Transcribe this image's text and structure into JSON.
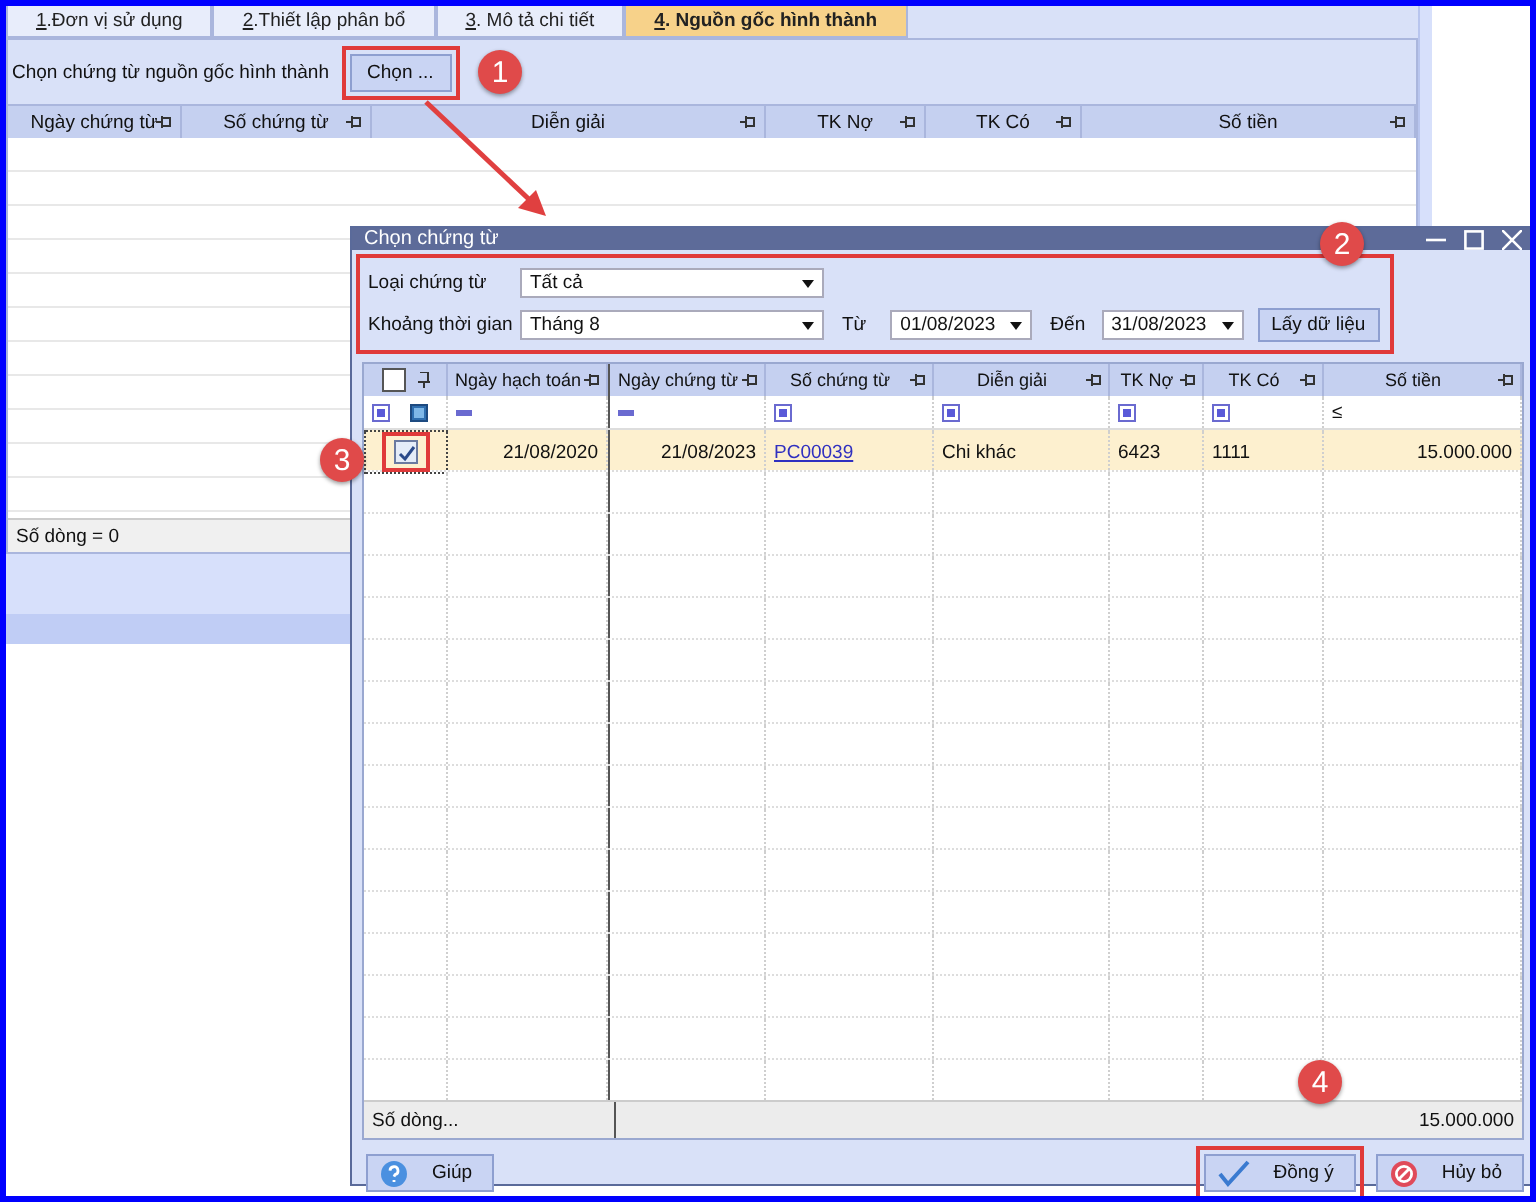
{
  "tabs": [
    {
      "label": "1.Đơn vị sử dụng",
      "selected": false
    },
    {
      "label": "2.Thiết lập phân bổ",
      "selected": false
    },
    {
      "label": "3. Mô tả chi tiết",
      "selected": false
    },
    {
      "label": "4. Nguồn gốc hình thành",
      "selected": true
    }
  ],
  "toolbar": {
    "label": "Chọn chứng từ nguồn gốc hình thành",
    "button": "Chọn ..."
  },
  "grid": {
    "columns": [
      "Ngày chứng từ",
      "Số chứng từ",
      "Diễn giải",
      "TK Nợ",
      "TK Có",
      "Số tiền"
    ],
    "footer": "Số dòng = 0"
  },
  "dialog": {
    "title": "Chọn chứng từ",
    "filters": {
      "type_label": "Loại chứng từ",
      "type_value": "Tất cả",
      "period_label": "Khoảng thời gian",
      "period_value": "Tháng 8",
      "from_label": "Từ",
      "from_value": "01/08/2023",
      "to_label": "Đến",
      "to_value": "31/08/2023",
      "fetch_button": "Lấy dữ liệu"
    },
    "table": {
      "select_all_checked": false,
      "columns": [
        "Ngày hạch toán",
        "Ngày chứng từ",
        "Số chứng từ",
        "Diễn giải",
        "TK Nợ",
        "TK Có",
        "Số tiền"
      ],
      "filter_row": [
        {
          "kind": "icons"
        },
        {
          "kind": "dash"
        },
        {
          "kind": "dash"
        },
        {
          "kind": "square"
        },
        {
          "kind": "square"
        },
        {
          "kind": "square"
        },
        {
          "kind": "square"
        },
        {
          "kind": "text",
          "text": "≤"
        }
      ],
      "rows": [
        {
          "checked": true,
          "selected": true,
          "posting_date": "21/08/2020",
          "doc_date": "21/08/2023",
          "doc_no": "PC00039",
          "description": "Chi khác",
          "debit": "6423",
          "credit": "1111",
          "amount": "15.000.000"
        }
      ],
      "footer_label": "Số dòng...",
      "footer_total": "15.000.000"
    },
    "buttons": {
      "help": "Giúp",
      "ok": "Đồng ý",
      "cancel": "Hủy bỏ"
    }
  },
  "annotations": [
    "1",
    "2",
    "3",
    "4"
  ]
}
